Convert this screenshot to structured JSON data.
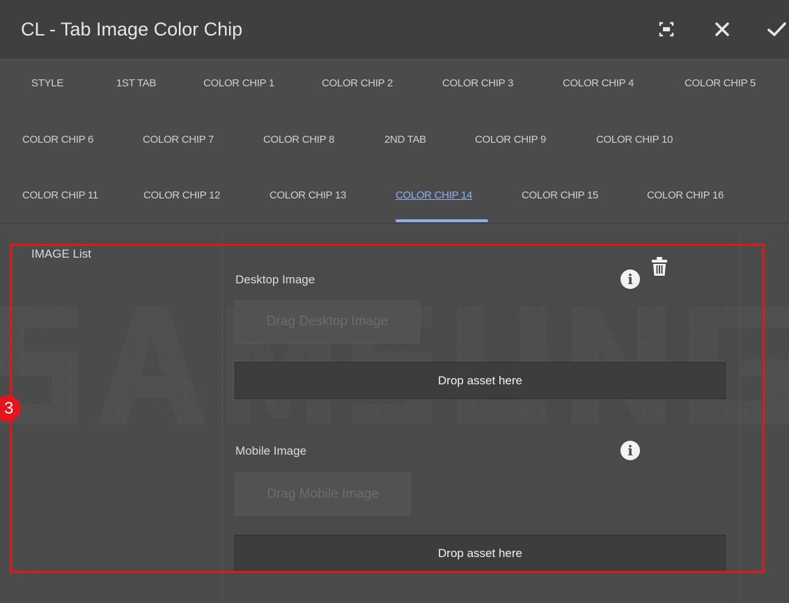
{
  "header": {
    "title": "CL - Tab Image Color Chip"
  },
  "tabs": {
    "row1": [
      "STYLE",
      "1ST TAB",
      "COLOR CHIP 1",
      "COLOR CHIP 2",
      "COLOR CHIP 3",
      "COLOR CHIP 4",
      "COLOR CHIP 5"
    ],
    "row2": [
      "COLOR CHIP 6",
      "COLOR CHIP 7",
      "COLOR CHIP 8",
      "2ND TAB",
      "COLOR CHIP 9",
      "COLOR CHIP 10"
    ],
    "row3": [
      "COLOR CHIP 11",
      "COLOR CHIP 12",
      "COLOR CHIP 13",
      "COLOR CHIP 14",
      "COLOR CHIP 15",
      "COLOR CHIP 16"
    ],
    "active": "COLOR CHIP 14"
  },
  "annotation": {
    "step_number": "3",
    "color": "#e4151b"
  },
  "image_list": {
    "label": "IMAGE List",
    "desktop": {
      "label": "Desktop Image",
      "drag_placeholder": "Drag Desktop Image",
      "drop_text": "Drop asset here"
    },
    "mobile": {
      "label": "Mobile Image",
      "drag_placeholder": "Drag Mobile Image",
      "drop_text": "Drop asset here"
    }
  },
  "icons": {
    "fullscreen": "fullscreen-icon",
    "close": "close-icon",
    "confirm": "check-icon",
    "info": "info-icon",
    "delete": "trash-icon"
  },
  "colors": {
    "active_tab": "#8fb0f0",
    "highlight": "#e4151b",
    "background": "#4b4b4b"
  }
}
